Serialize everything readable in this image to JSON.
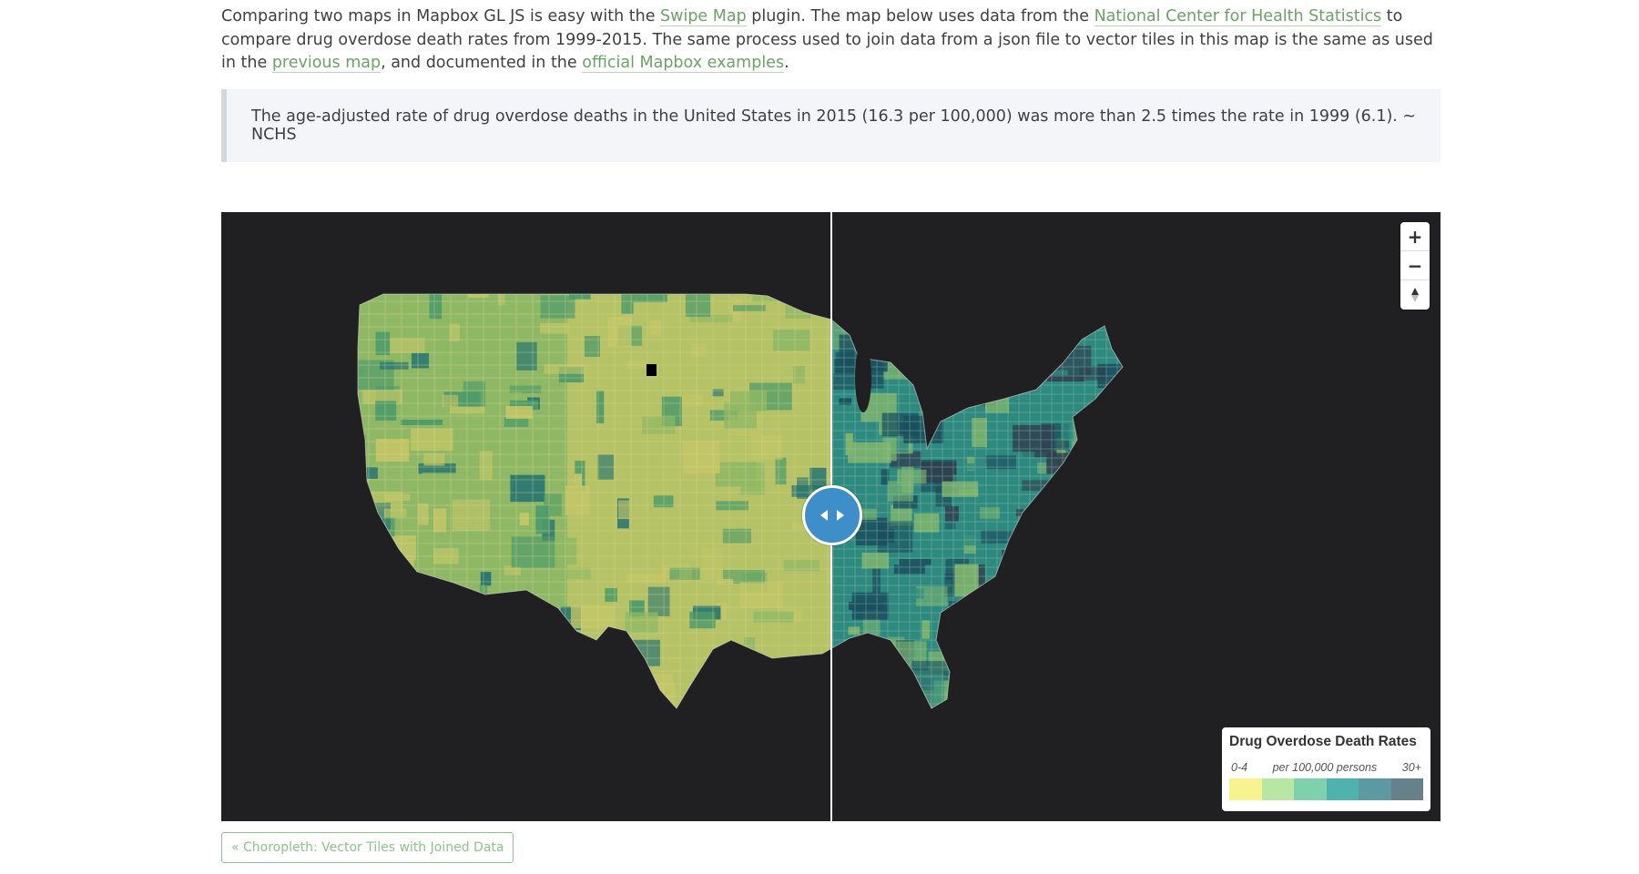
{
  "intro": {
    "t1": "Comparing two maps in Mapbox GL JS is easy with the ",
    "link_swipe": "Swipe Map",
    "t2": " plugin. The map below uses data from the ",
    "link_nchs": "National Center for Health Statistics",
    "t3": " to compare drug overdose death rates from 1999-2015. The same process used to join data from a json file to vector tiles in this map is the same as used in the ",
    "link_previous": "previous map",
    "t4": ", and documented in the ",
    "link_examples": "official Mapbox examples",
    "t5": "."
  },
  "quote": {
    "text": "The age-adjusted rate of drug overdose deaths in the United States in 2015 (16.3 per 100,000) was more than 2.5 times the rate in 1999 (6.1). ~ NCHS"
  },
  "map": {
    "background": "#202022",
    "swipe_position": 0.5,
    "nav": {
      "zoom_in": "+",
      "zoom_out": "−",
      "compass": "▲"
    },
    "legend": {
      "title": "Drug Overdose Death Rates",
      "min_label": "0-4",
      "unit_label": "per 100,000 persons",
      "max_label": "30+",
      "colors": [
        "#f7f38f",
        "#b8e6a3",
        "#7fd0ad",
        "#4fb3ad",
        "#5b9aa3",
        "#66808c"
      ]
    },
    "palette_1999": {
      "base": "#8fb865",
      "light": "#c4c667",
      "dark": "#4d9a6a",
      "accent": "#1f6f73"
    },
    "palette_2015": {
      "base": "#2e8a7f",
      "light": "#7fb56d",
      "dark": "#1a4f5e",
      "accent": "#2f3f4f"
    }
  },
  "footer": {
    "prev_link": "« Choropleth: Vector Tiles with Joined Data"
  }
}
